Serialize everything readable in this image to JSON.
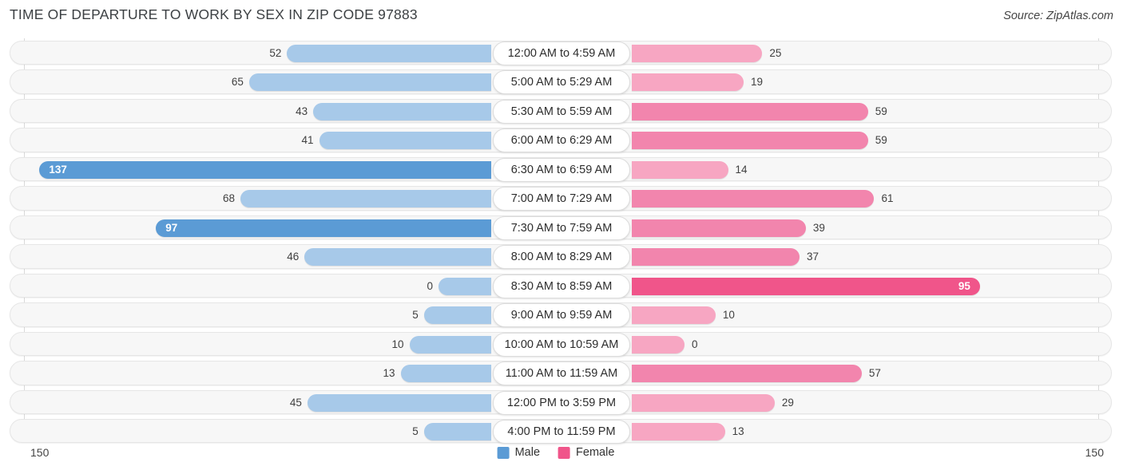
{
  "header": {
    "title": "TIME OF DEPARTURE TO WORK BY SEX IN ZIP CODE 97883",
    "source": "Source: ZipAtlas.com"
  },
  "legend": {
    "male_label": "Male",
    "female_label": "Female",
    "male_color": "#5b9bd5",
    "female_color": "#f0558a"
  },
  "axis": {
    "left_max": "150",
    "right_max": "150"
  },
  "chart_data": {
    "type": "bar",
    "orientation": "diverging-horizontal",
    "title": "TIME OF DEPARTURE TO WORK BY SEX IN ZIP CODE 97883",
    "xlabel": "",
    "ylabel": "",
    "xlim": [
      0,
      150
    ],
    "grid": false,
    "legend_position": "bottom-center",
    "categories": [
      "12:00 AM to 4:59 AM",
      "5:00 AM to 5:29 AM",
      "5:30 AM to 5:59 AM",
      "6:00 AM to 6:29 AM",
      "6:30 AM to 6:59 AM",
      "7:00 AM to 7:29 AM",
      "7:30 AM to 7:59 AM",
      "8:00 AM to 8:29 AM",
      "8:30 AM to 8:59 AM",
      "9:00 AM to 9:59 AM",
      "10:00 AM to 10:59 AM",
      "11:00 AM to 11:59 AM",
      "12:00 PM to 3:59 PM",
      "4:00 PM to 11:59 PM"
    ],
    "series": [
      {
        "name": "Male",
        "values": [
          52,
          65,
          43,
          41,
          137,
          68,
          97,
          46,
          0,
          5,
          10,
          13,
          45,
          5
        ]
      },
      {
        "name": "Female",
        "values": [
          25,
          19,
          59,
          59,
          14,
          61,
          39,
          37,
          95,
          10,
          0,
          57,
          29,
          13
        ]
      }
    ]
  },
  "rows": [
    {
      "category": "12:00 AM to 4:59 AM",
      "male": "52",
      "female": "25"
    },
    {
      "category": "5:00 AM to 5:29 AM",
      "male": "65",
      "female": "19"
    },
    {
      "category": "5:30 AM to 5:59 AM",
      "male": "43",
      "female": "59"
    },
    {
      "category": "6:00 AM to 6:29 AM",
      "male": "41",
      "female": "59"
    },
    {
      "category": "6:30 AM to 6:59 AM",
      "male": "137",
      "female": "14"
    },
    {
      "category": "7:00 AM to 7:29 AM",
      "male": "68",
      "female": "61"
    },
    {
      "category": "7:30 AM to 7:59 AM",
      "male": "97",
      "female": "39"
    },
    {
      "category": "8:00 AM to 8:29 AM",
      "male": "46",
      "female": "37"
    },
    {
      "category": "8:30 AM to 8:59 AM",
      "male": "0",
      "female": "95"
    },
    {
      "category": "9:00 AM to 9:59 AM",
      "male": "5",
      "female": "10"
    },
    {
      "category": "10:00 AM to 10:59 AM",
      "male": "10",
      "female": "0"
    },
    {
      "category": "11:00 AM to 11:59 AM",
      "male": "13",
      "female": "57"
    },
    {
      "category": "12:00 PM to 3:59 PM",
      "male": "45",
      "female": "29"
    },
    {
      "category": "4:00 PM to 11:59 PM",
      "male": "5",
      "female": "13"
    }
  ]
}
